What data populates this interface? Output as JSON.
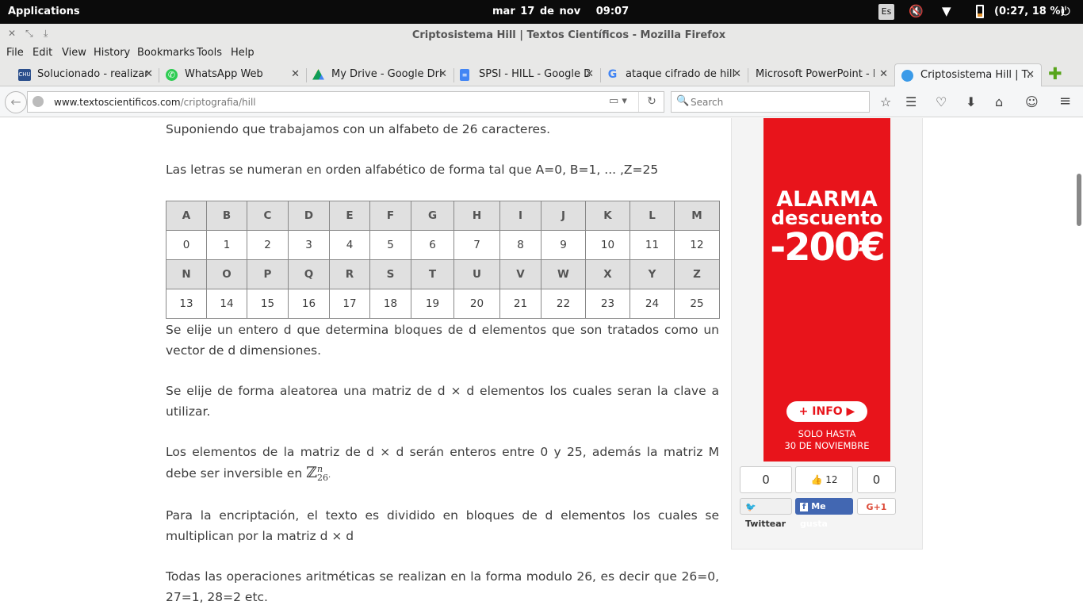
{
  "system": {
    "apps_label": "Applications",
    "date": "mar 17 de nov",
    "time": "09:07",
    "lang": "Es",
    "battery": "(0:27, 18 %)"
  },
  "window": {
    "title": "Criptosistema Hill | Textos Científicos - Mozilla Firefox"
  },
  "menu": {
    "file": "File",
    "edit": "Edit",
    "view": "View",
    "history": "History",
    "bookmarks": "Bookmarks",
    "tools": "Tools",
    "help": "Help"
  },
  "tabs": [
    {
      "label": "Solucionado - realizar...",
      "icon": "chu-icon"
    },
    {
      "label": "WhatsApp Web",
      "icon": "whatsapp-icon"
    },
    {
      "label": "My Drive - Google Drive",
      "icon": "drive-icon"
    },
    {
      "label": "SPSI - HILL - Google D...",
      "icon": "docs-icon"
    },
    {
      "label": "ataque cifrado de hill ...",
      "icon": "google-icon"
    },
    {
      "label": "Microsoft PowerPoint - Hi...",
      "icon": "none"
    },
    {
      "label": "Criptosistema Hill | T...",
      "icon": "globe-icon"
    }
  ],
  "nav": {
    "url_host": "www.textoscientificos.com",
    "url_path": "/criptografia/hill",
    "search_placeholder": "Search"
  },
  "article": {
    "p1": "Suponiendo que trabajamos con un alfabeto de 26 caracteres.",
    "p2": "Las letras se numeran en orden alfabético de forma tal que A=0, B=1, ... ,Z=25",
    "p3": "Se elije un entero d que determina bloques de d elementos que son tratados como un vector de d dimensiones.",
    "p4": "Se elije de forma aleatorea una matriz de d × d elementos los cuales seran la clave a utilizar.",
    "p5": "Los elementos de la matriz de d × d serán enteros entre 0 y 25, además la matriz M debe ser inversible en",
    "p5_sym": "ℤ",
    "p5_sup": "n",
    "p5_sub": "26",
    "p5_end": ".",
    "p6": "Para la encriptación, el texto es dividido en bloques de d elementos los cuales se multiplican por la matriz d × d",
    "p7": "Todas las operaciones aritméticas se realizan en la forma modulo 26, es decir que 26=0, 27=1, 28=2 etc."
  },
  "alphabet": {
    "row1": [
      "A",
      "B",
      "C",
      "D",
      "E",
      "F",
      "G",
      "H",
      "I",
      "J",
      "K",
      "L",
      "M"
    ],
    "row2": [
      "0",
      "1",
      "2",
      "3",
      "4",
      "5",
      "6",
      "7",
      "8",
      "9",
      "10",
      "11",
      "12"
    ],
    "row3": [
      "N",
      "O",
      "P",
      "Q",
      "R",
      "S",
      "T",
      "U",
      "V",
      "W",
      "X",
      "Y",
      "Z"
    ],
    "row4": [
      "13",
      "14",
      "15",
      "16",
      "17",
      "18",
      "19",
      "20",
      "21",
      "22",
      "23",
      "24",
      "25"
    ]
  },
  "ad": {
    "line1": "ALARMA",
    "line2": "descuento",
    "line3": "-200€",
    "button": "+ INFO ▶",
    "line4": "SOLO HASTA",
    "line5": "30 DE NOVIEMBRE"
  },
  "social": {
    "tweet_count": "0",
    "like_count": "12",
    "gplus_count": "0",
    "tweet_label": "Twittear",
    "like_label": "Me gusta",
    "gplus_label": "G+1"
  }
}
